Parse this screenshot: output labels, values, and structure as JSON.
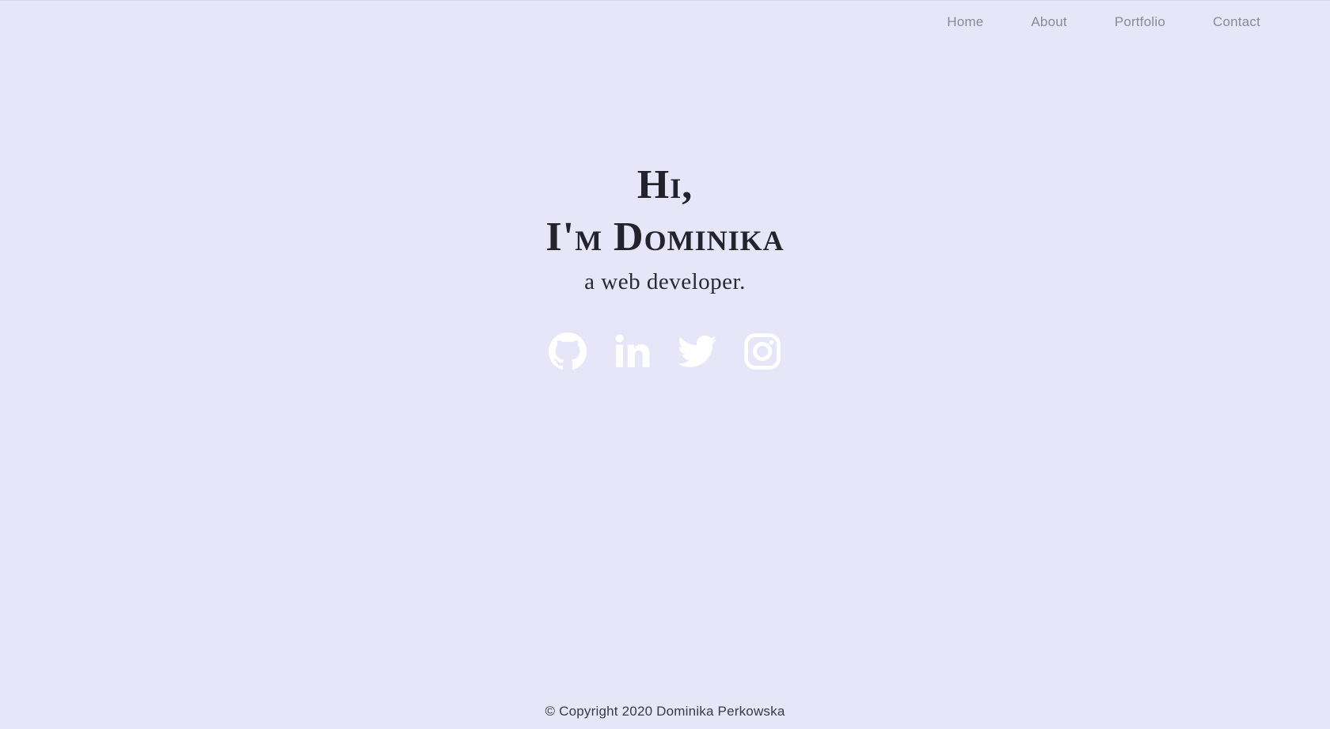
{
  "nav": {
    "items": [
      {
        "label": "Home"
      },
      {
        "label": "About"
      },
      {
        "label": "Portfolio"
      },
      {
        "label": "Contact"
      }
    ]
  },
  "hero": {
    "line1": "Hi,",
    "line2": "I'm Dominika",
    "subtitle": "a web developer."
  },
  "social": {
    "icons": [
      "github-icon",
      "linkedin-icon",
      "twitter-icon",
      "instagram-icon"
    ],
    "icon_color": "#ffffff"
  },
  "footer": {
    "copyright": "© Copyright 2020 Dominika Perkowska"
  },
  "colors": {
    "background": "#e6e6f8",
    "nav_text": "#8a8a96",
    "heading_text": "#24232c"
  }
}
